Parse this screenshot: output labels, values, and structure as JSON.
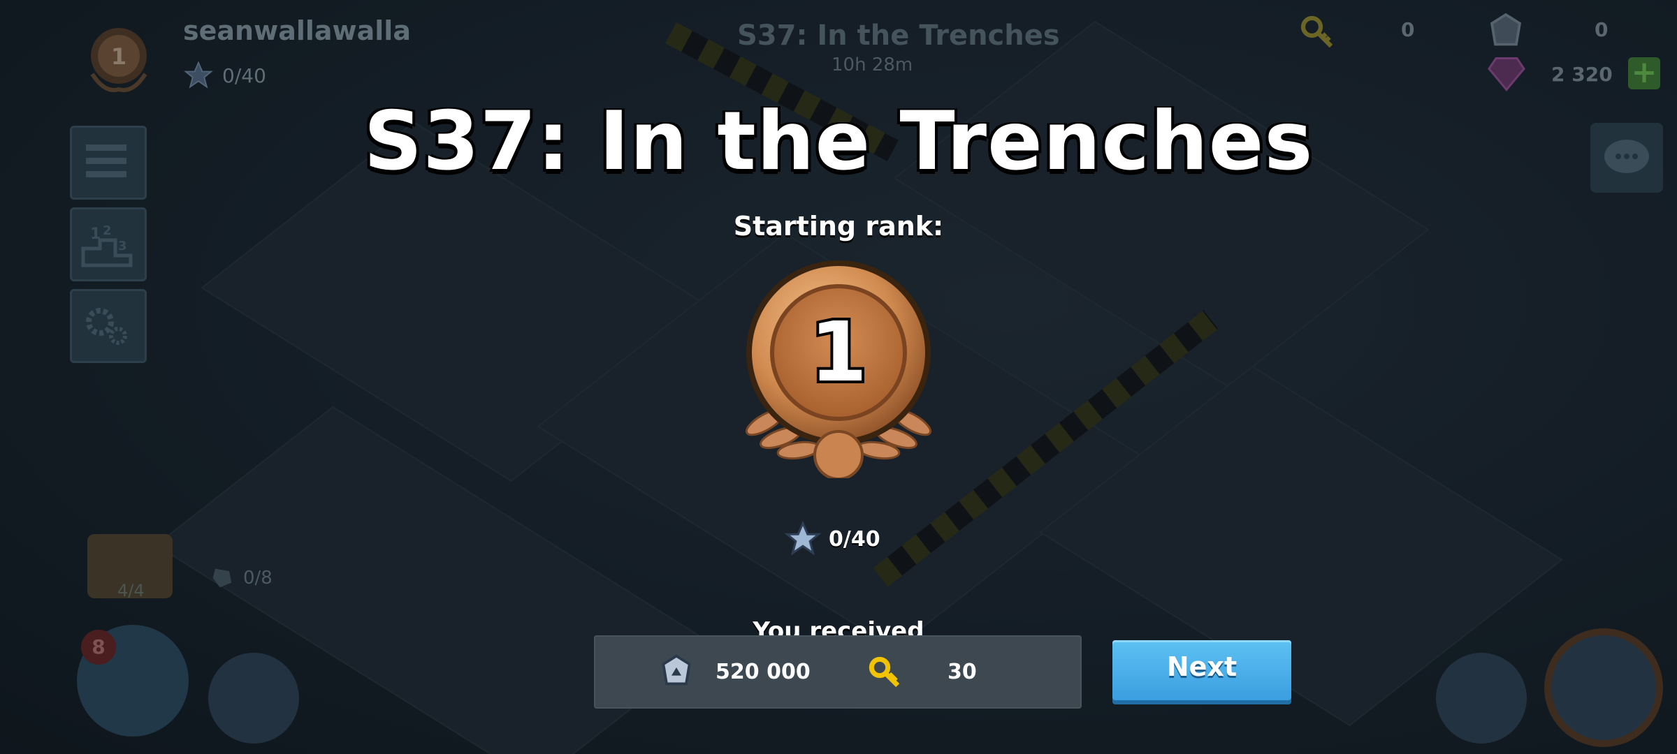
{
  "player": {
    "name": "seanwallawalla",
    "rank": "1",
    "stars": "0/40"
  },
  "season_bg": {
    "title": "S37: In the Trenches",
    "timer": "10h 28m"
  },
  "resources": {
    "keys": "0",
    "intel": "0",
    "diamonds": "2 320"
  },
  "side_menu": {
    "icons": [
      "menu-icon",
      "leaderboard-icon",
      "settings-icon"
    ]
  },
  "bottom_left": {
    "chest_count": "4/4",
    "fragments": "0/8",
    "troop_badge": "8"
  },
  "popup": {
    "title": "S37: In the Trenches",
    "starting_rank_label": "Starting rank:",
    "rank_number": "1",
    "star_progress": "0/40",
    "received_label": "You received",
    "reward_intel": "520 000",
    "reward_keys": "30",
    "next_label": "Next"
  },
  "colors": {
    "bronze": "#c98a55",
    "next_button": "#4aaee8",
    "background": "#1c2a33"
  }
}
